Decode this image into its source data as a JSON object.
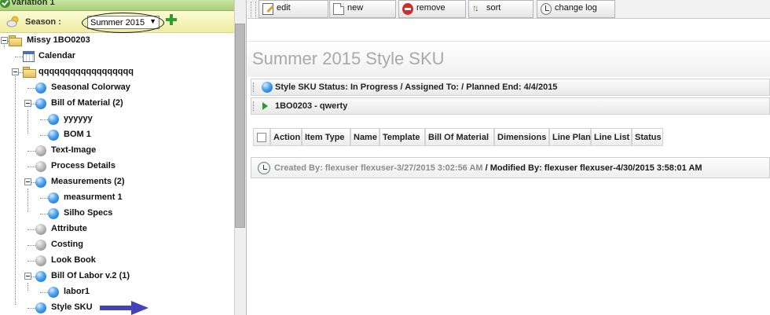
{
  "left_panel": {
    "variation_label": "Variation 1",
    "season_label": "Season :",
    "season_value": "Summer 2015",
    "tree": [
      {
        "label": "Missy   1BO0203",
        "icon": "folder-icon",
        "state": "expanded"
      },
      {
        "label": "Calendar",
        "icon": "calendar-icon"
      },
      {
        "label": "qqqqqqqqqqqqqqqqqq",
        "icon": "folder-icon",
        "state": "expanded"
      },
      {
        "label": "Seasonal Colorway",
        "icon": "blue-node-icon"
      },
      {
        "label": "Bill of Material (2)",
        "icon": "blue-node-icon",
        "state": "expanded"
      },
      {
        "label": "yyyyyy",
        "icon": "blue-node-icon"
      },
      {
        "label": "BOM 1",
        "icon": "blue-node-icon"
      },
      {
        "label": "Text-Image",
        "icon": "gray-node-icon"
      },
      {
        "label": "Process Details",
        "icon": "gray-node-icon"
      },
      {
        "label": "Measurements (2)",
        "icon": "blue-node-icon",
        "state": "expanded"
      },
      {
        "label": "measurment 1",
        "icon": "blue-node-icon"
      },
      {
        "label": "Silho Specs",
        "icon": "blue-node-icon"
      },
      {
        "label": "Attribute",
        "icon": "gray-node-icon"
      },
      {
        "label": "Costing",
        "icon": "gray-node-icon"
      },
      {
        "label": "Look Book",
        "icon": "gray-node-icon"
      },
      {
        "label": "Bill Of Labor v.2 (1)",
        "icon": "blue-node-icon",
        "state": "expanded"
      },
      {
        "label": "labor1",
        "icon": "blue-node-icon"
      },
      {
        "label": "Style SKU",
        "icon": "blue-node-icon"
      }
    ]
  },
  "toolbar": {
    "buttons": [
      {
        "label": "edit",
        "icon": "edit-icon"
      },
      {
        "label": "new",
        "icon": "new-document-icon"
      },
      {
        "label": "remove",
        "icon": "remove-icon"
      },
      {
        "label": "sort",
        "icon": "sort-icon"
      },
      {
        "label": "change log",
        "icon": "change-log-icon"
      }
    ]
  },
  "main": {
    "page_title": "Summer 2015 Style SKU",
    "status_header": "Style SKU  Status: In Progress / Assigned To:  / Planned End: 4/4/2015",
    "sub_header": "1BO0203 - qwerty",
    "table_headers": [
      "Action",
      "Item Type",
      "Name",
      "Template",
      "Bill Of Material",
      "Dimensions",
      "Line Plan",
      "Line List",
      "Status"
    ],
    "footer": {
      "created": "Created By: flexuser flexuser-3/27/2015 3:02:56 AM",
      "separator": " / ",
      "modified": "Modified By: flexuser flexuser-4/30/2015 3:58:01 AM"
    }
  },
  "colors": {
    "variation_bar": "#a8cf77",
    "season_bar": "#efeda0",
    "title_gray": "#a9a9a9",
    "annotation_arrow": "#3f3fb0"
  }
}
